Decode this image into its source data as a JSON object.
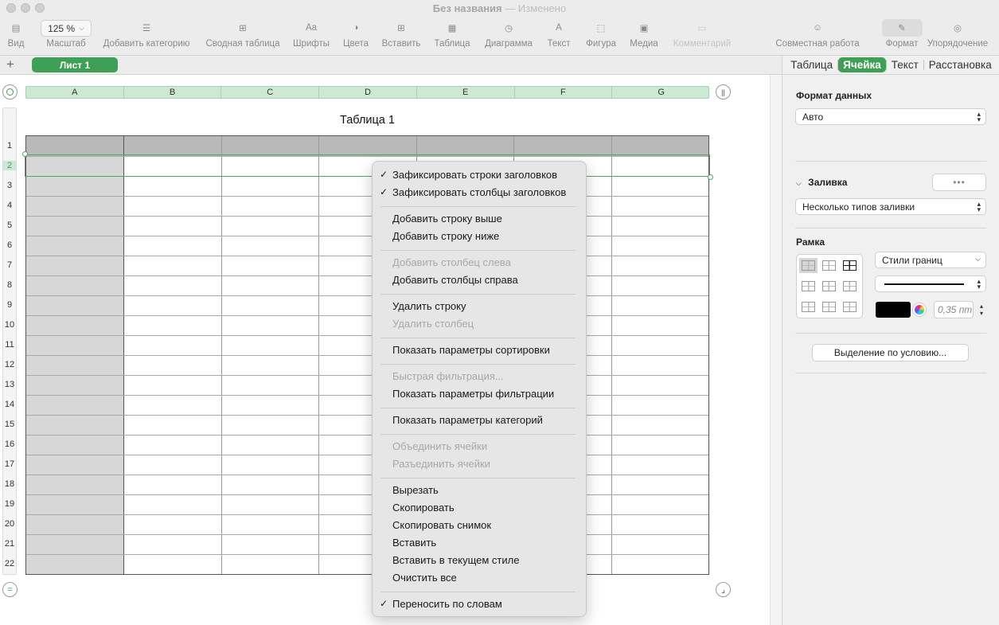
{
  "window": {
    "title": "Без названия",
    "separator": "—",
    "status": "Изменено"
  },
  "toolbar": {
    "zoom_value": "125 %",
    "items": [
      {
        "label": "Вид",
        "icon": "sidebar-icon"
      },
      {
        "label": "Масштаб",
        "icon": "zoom-icon"
      },
      {
        "label": "Добавить категорию",
        "icon": "list-icon"
      },
      {
        "label": "Сводная таблица",
        "icon": "pivot-table-icon"
      },
      {
        "label": "Шрифты",
        "icon": "fonts-icon"
      },
      {
        "label": "Цвета",
        "icon": "colors-icon"
      },
      {
        "label": "Вставить",
        "icon": "insert-icon"
      },
      {
        "label": "Таблица",
        "icon": "table-icon"
      },
      {
        "label": "Диаграмма",
        "icon": "chart-icon"
      },
      {
        "label": "Текст",
        "icon": "text-icon"
      },
      {
        "label": "Фигура",
        "icon": "shape-icon"
      },
      {
        "label": "Медиа",
        "icon": "media-icon"
      },
      {
        "label": "Комментарий",
        "icon": "comment-icon"
      },
      {
        "label": "Совместная работа",
        "icon": "collaborate-icon"
      },
      {
        "label": "Формат",
        "icon": "format-brush-icon"
      },
      {
        "label": "Упорядочение",
        "icon": "arrange-icon"
      }
    ]
  },
  "sheet": {
    "add_label": "+",
    "tab_label": "Лист 1"
  },
  "sidebar": {
    "tabs": [
      "Таблица",
      "Ячейка",
      "Текст",
      "Расстановка"
    ],
    "active_tab": "Ячейка",
    "data_format_title": "Формат данных",
    "data_format_value": "Авто",
    "fill_title": "Заливка",
    "fill_more": "•••",
    "fill_value": "Несколько типов заливки",
    "border_title": "Рамка",
    "border_styles": "Стили границ",
    "stroke_color": "#000000",
    "stroke_width": "0,35 пт",
    "conditional_button": "Выделение по условию..."
  },
  "table": {
    "title": "Таблица 1",
    "columns": [
      "A",
      "B",
      "C",
      "D",
      "E",
      "F",
      "G"
    ],
    "rows": [
      "1",
      "2",
      "3",
      "4",
      "5",
      "6",
      "7",
      "8",
      "9",
      "10",
      "11",
      "12",
      "13",
      "14",
      "15",
      "16",
      "17",
      "18",
      "19",
      "20",
      "21",
      "22"
    ],
    "selected_row": "2",
    "header_color": "#b9b9b9",
    "header_column_color": "#d7d7d7",
    "accent_color": "#3f9f54"
  },
  "context_menu": {
    "groups": [
      [
        {
          "label": "Зафиксировать строки заголовков",
          "checked": true,
          "enabled": true
        },
        {
          "label": "Зафиксировать столбцы заголовков",
          "checked": true,
          "enabled": true
        }
      ],
      [
        {
          "label": "Добавить строку выше",
          "enabled": true
        },
        {
          "label": "Добавить строку ниже",
          "enabled": true
        }
      ],
      [
        {
          "label": "Добавить столбец слева",
          "enabled": false
        },
        {
          "label": "Добавить столбцы справа",
          "enabled": true
        }
      ],
      [
        {
          "label": "Удалить строку",
          "enabled": true
        },
        {
          "label": "Удалить столбец",
          "enabled": false
        }
      ],
      [
        {
          "label": "Показать параметры сортировки",
          "enabled": true
        }
      ],
      [
        {
          "label": "Быстрая фильтрация...",
          "enabled": false
        },
        {
          "label": "Показать параметры фильтрации",
          "enabled": true
        }
      ],
      [
        {
          "label": "Показать параметры категорий",
          "enabled": true
        }
      ],
      [
        {
          "label": "Объединить ячейки",
          "enabled": false
        },
        {
          "label": "Разъединить ячейки",
          "enabled": false
        }
      ],
      [
        {
          "label": "Вырезать",
          "enabled": true
        },
        {
          "label": "Скопировать",
          "enabled": true
        },
        {
          "label": "Скопировать снимок",
          "enabled": true
        },
        {
          "label": "Вставить",
          "enabled": true
        },
        {
          "label": "Вставить в текущем стиле",
          "enabled": true
        },
        {
          "label": "Очистить все",
          "enabled": true
        }
      ],
      [
        {
          "label": "Переносить по словам",
          "checked": true,
          "enabled": true
        }
      ]
    ]
  }
}
